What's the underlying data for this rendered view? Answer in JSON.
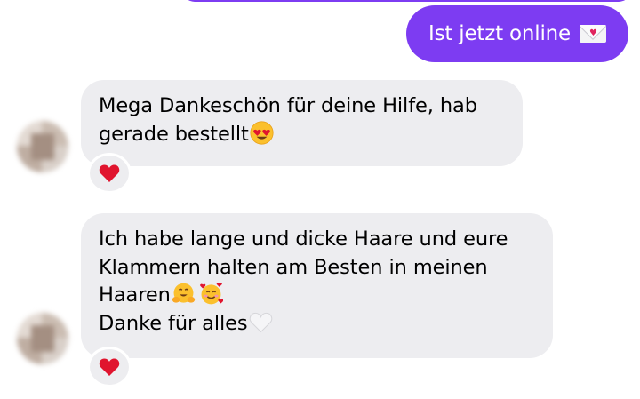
{
  "colors": {
    "outgoing_bubble": "#7d3cf2",
    "incoming_bubble": "#ededf0",
    "reaction_heart": "#e0142e"
  },
  "messages": [
    {
      "direction": "outgoing",
      "text": "Ist jetzt online",
      "emoji": [
        "love-letter-icon"
      ]
    },
    {
      "direction": "incoming",
      "lines": [
        "Mega Dankeschön für deine Hilfe, hab",
        "gerade bestellt"
      ],
      "emoji": [
        "heart-eyes-emoji-icon"
      ],
      "reaction": "red-heart-icon"
    },
    {
      "direction": "incoming",
      "lines": [
        "Ich habe lange und dicke Haare und eure",
        "Klammern halten am Besten in meinen",
        "Haaren",
        "Danke für alles"
      ],
      "emoji": [
        "hugging-face-emoji-icon",
        "smiling-face-with-hearts-emoji-icon",
        "white-heart-emoji-icon"
      ],
      "reaction": "red-heart-icon"
    }
  ]
}
